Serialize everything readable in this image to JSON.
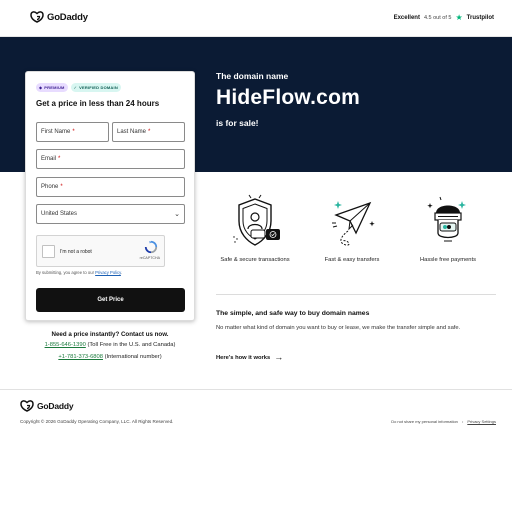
{
  "header": {
    "brand": "GoDaddy",
    "trust_rating_word": "Excellent",
    "trust_score_text": "4.5 out of 5",
    "trust_brand": "Trustpilot"
  },
  "hero": {
    "pre": "The domain name",
    "domain": "HideFlow.com",
    "post": "is for sale!",
    "background_color": "#0b1b34"
  },
  "form": {
    "badge_premium": "PREMIUM",
    "badge_verified": "VERIFIED DOMAIN",
    "title": "Get a price in less than 24 hours",
    "first_name_placeholder": "First Name",
    "last_name_placeholder": "Last Name",
    "email_placeholder": "Email",
    "phone_placeholder": "Phone",
    "required_mark": "*",
    "country_value": "United States",
    "captcha_label": "I'm not a robot",
    "captcha_brand": "reCAPTCHA",
    "consent_prefix": "By submitting, you agree to our",
    "consent_link": "Privacy Policy",
    "consent_suffix": ".",
    "submit_label": "Get Price"
  },
  "contact": {
    "title": "Need a price instantly? Contact us now.",
    "phone1": "1-855-646-1390",
    "phone1_note": "(Toll Free in the U.S. and Canada)",
    "phone2": "+1-781-373-6808",
    "phone2_note": "(International number)"
  },
  "features": [
    {
      "icon": "shield-lock-icon",
      "caption": "Safe & secure transactions"
    },
    {
      "icon": "paper-plane-icon",
      "caption": "Fast & easy transfers"
    },
    {
      "icon": "payment-card-icon",
      "caption": "Hassle free payments"
    }
  ],
  "info": {
    "title": "The simple, and safe way to buy domain names",
    "text": "No matter what kind of domain you want to buy or lease, we make the transfer simple and safe.",
    "link": "Here's how it works"
  },
  "footer": {
    "brand": "GoDaddy",
    "copyright": "Copyright © 2026 GoDaddy Operating Company, LLC. All Rights Reserved.",
    "link1": "Do not share my personal information",
    "separator": "•",
    "link2": "Privacy Settings"
  },
  "colors": {
    "accent_green": "#00b67a",
    "phone_link": "#1a7a3c",
    "button": "#111111"
  }
}
